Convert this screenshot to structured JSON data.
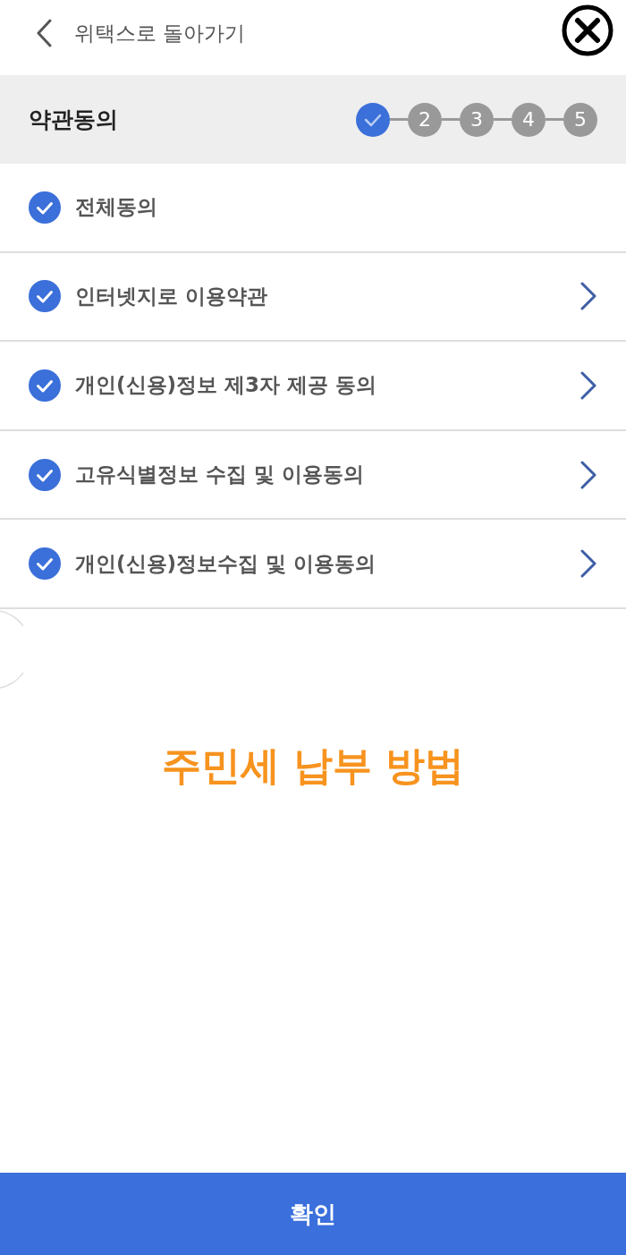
{
  "header": {
    "back_label": "위택스로 돌아가기"
  },
  "section": {
    "title": "약관동의",
    "steps": [
      {
        "completed": true
      },
      {
        "completed": false,
        "label": "2"
      },
      {
        "completed": false,
        "label": "3"
      },
      {
        "completed": false,
        "label": "4"
      },
      {
        "completed": false,
        "label": "5"
      }
    ]
  },
  "items": [
    {
      "kind": "all",
      "label": "전체동의",
      "checked": true
    },
    {
      "kind": "term",
      "label": "인터넷지로 이용약관",
      "checked": true
    },
    {
      "kind": "term",
      "label": "개인(신용)정보 제3자 제공 동의",
      "checked": true
    },
    {
      "kind": "term",
      "label": "고유식별정보 수집 및 이용동의",
      "checked": true
    },
    {
      "kind": "term",
      "label": "개인(신용)정보수집 및 이용동의",
      "checked": true
    }
  ],
  "caption": "주민세 납부 방법",
  "confirm_button": "확인"
}
